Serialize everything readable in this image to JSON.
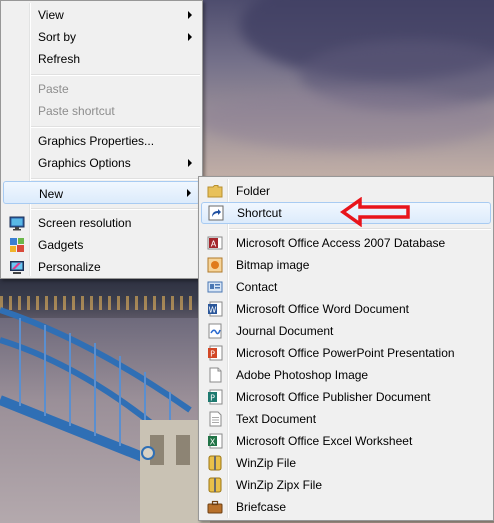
{
  "context_menu": {
    "items": [
      {
        "label": "View",
        "submenu": true,
        "enabled": true
      },
      {
        "label": "Sort by",
        "submenu": true,
        "enabled": true
      },
      {
        "label": "Refresh",
        "submenu": false,
        "enabled": true
      },
      {
        "label": "Paste",
        "submenu": false,
        "enabled": false
      },
      {
        "label": "Paste shortcut",
        "submenu": false,
        "enabled": false
      },
      {
        "label": "Graphics Properties...",
        "submenu": false,
        "enabled": true
      },
      {
        "label": "Graphics Options",
        "submenu": true,
        "enabled": true
      },
      {
        "label": "New",
        "submenu": true,
        "enabled": true,
        "highlighted": true
      },
      {
        "label": "Screen resolution",
        "icon": "screen-resolution-icon",
        "enabled": true
      },
      {
        "label": "Gadgets",
        "icon": "gadgets-icon",
        "enabled": true
      },
      {
        "label": "Personalize",
        "icon": "personalize-icon",
        "enabled": true
      }
    ]
  },
  "new_submenu": {
    "items": [
      {
        "label": "Folder",
        "icon": "folder-icon"
      },
      {
        "label": "Shortcut",
        "icon": "shortcut-icon",
        "highlighted": true
      },
      {
        "label": "Microsoft Office Access 2007 Database",
        "icon": "access-icon"
      },
      {
        "label": "Bitmap image",
        "icon": "bitmap-icon"
      },
      {
        "label": "Contact",
        "icon": "contact-icon"
      },
      {
        "label": "Microsoft Office Word Document",
        "icon": "word-icon"
      },
      {
        "label": "Journal Document",
        "icon": "journal-icon"
      },
      {
        "label": "Microsoft Office PowerPoint Presentation",
        "icon": "powerpoint-icon"
      },
      {
        "label": "Adobe Photoshop Image",
        "icon": "photoshop-icon"
      },
      {
        "label": "Microsoft Office Publisher Document",
        "icon": "publisher-icon"
      },
      {
        "label": "Text Document",
        "icon": "text-document-icon"
      },
      {
        "label": "Microsoft Office Excel Worksheet",
        "icon": "excel-icon"
      },
      {
        "label": "WinZip File",
        "icon": "winzip-icon"
      },
      {
        "label": "WinZip Zipx File",
        "icon": "winzip-zipx-icon"
      },
      {
        "label": "Briefcase",
        "icon": "briefcase-icon"
      }
    ]
  },
  "colors": {
    "highlight_border": "#a8cbf2",
    "highlight_fill": "#dcebfc",
    "menu_bg": "#f0f0f0",
    "disabled_text": "#8d8d8d",
    "callout_arrow": "#e8141b"
  }
}
